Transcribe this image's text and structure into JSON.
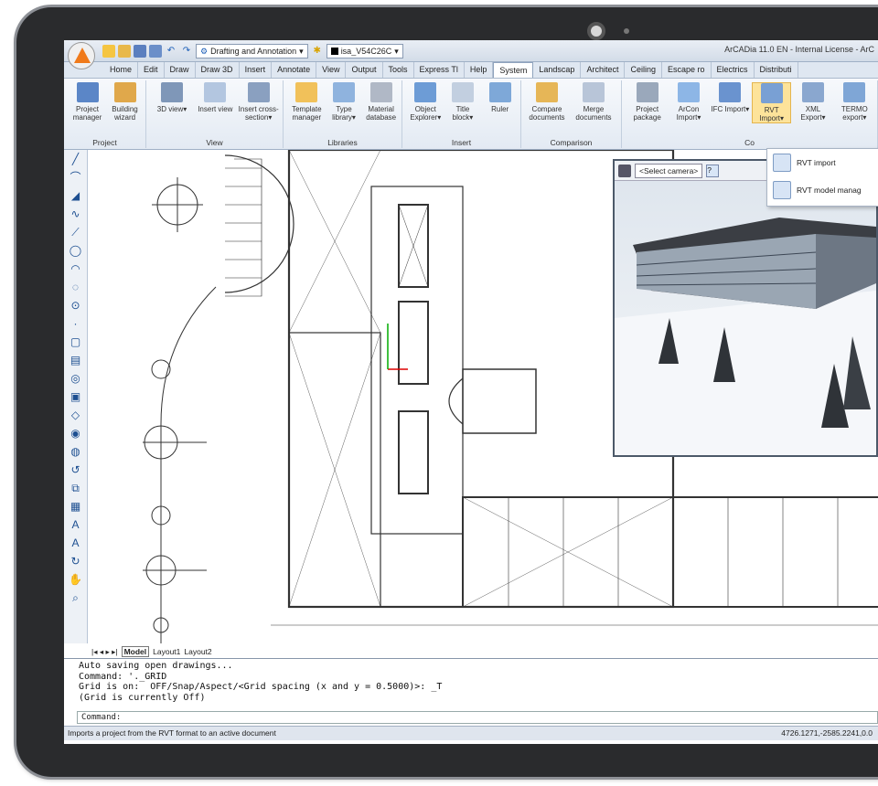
{
  "app": {
    "window_title": "ArCADia 11.0 EN - Internal License - ArC",
    "workspace": "Drafting and Annotation",
    "layer": "isa_V54C26C"
  },
  "tabs": [
    "Home",
    "Edit",
    "Draw",
    "Draw 3D",
    "Insert",
    "Annotate",
    "View",
    "Output",
    "Tools",
    "Express Tl",
    "Help",
    "System",
    "Landscap",
    "Architect",
    "Ceiling",
    "Escape ro",
    "Electrics",
    "Distributi"
  ],
  "active_tab": "System",
  "ribbon": {
    "groups": [
      {
        "label": "Project",
        "buttons": [
          "Project manager",
          "Building wizard"
        ]
      },
      {
        "label": "View",
        "buttons": [
          "3D view▾",
          "Insert view",
          "Insert cross-section▾"
        ]
      },
      {
        "label": "Libraries",
        "buttons": [
          "Template manager",
          "Type library▾",
          "Material database"
        ]
      },
      {
        "label": "Insert",
        "buttons": [
          "Object Explorer▾",
          "Title block▾",
          "Ruler"
        ]
      },
      {
        "label": "Comparison",
        "buttons": [
          "Compare documents",
          "Merge documents"
        ]
      },
      {
        "label": "Co",
        "buttons": [
          "Project package",
          "ArCon Import▾",
          "IFC Import▾",
          "RVT Import▾",
          "XML Export▾",
          "TERMO export▾"
        ]
      }
    ]
  },
  "dropdown": {
    "items": [
      "RVT import",
      "RVT model manag"
    ]
  },
  "camera": {
    "select_label": "<Select camera>"
  },
  "layout_tabs": [
    "Model",
    "Layout1",
    "Layout2"
  ],
  "command": {
    "lines": [
      "Auto saving open drawings...",
      "Command: '._GRID",
      "Grid is on:  OFF/Snap/Aspect/<Grid spacing (x and y = 0.5000)>: _T",
      "(Grid is currently Off)"
    ],
    "prompt": "Command:"
  },
  "status": {
    "text": "Imports a project from the RVT format to an active document",
    "coords": "4726.1271,-2585.2241,0.0"
  },
  "colors": {
    "accent": "#f07a1a",
    "frame": "#2a2b2d",
    "ribbon": "#e3eaf3"
  }
}
